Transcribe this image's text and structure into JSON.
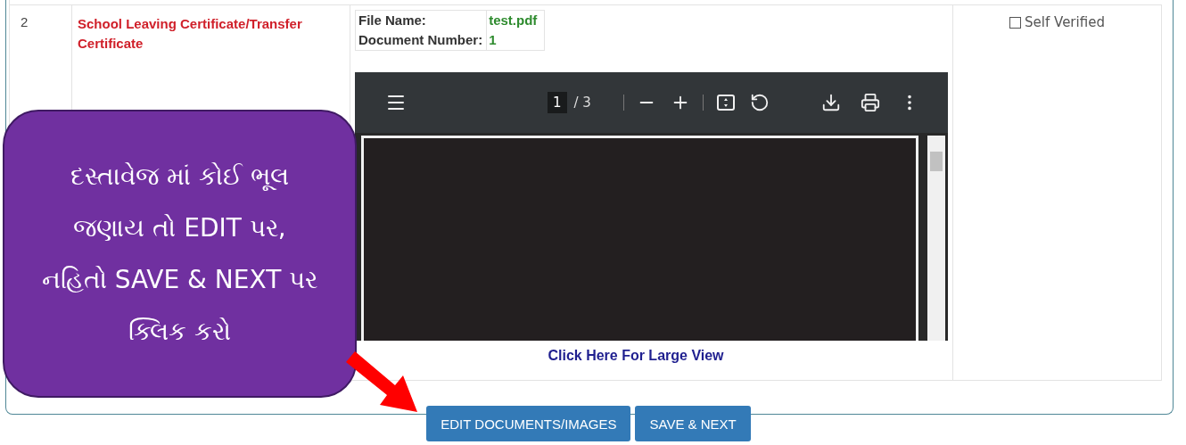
{
  "rows": [
    {
      "number": "2",
      "document_name": "School Leaving Certificate/Transfer Certificate",
      "file_fields": [
        {
          "label": "File Name:",
          "value": "test.pdf"
        },
        {
          "label": "Document Number:",
          "value": "1"
        }
      ],
      "viewer": {
        "page": "1",
        "page_count": "/ 3"
      },
      "large_view_link": "Click Here For Large View",
      "self_verified": {
        "label": "Self Verified",
        "checked": false
      }
    }
  ],
  "buttons": [
    {
      "label": "EDIT DOCUMENTS/IMAGES"
    },
    {
      "label": "SAVE & NEXT"
    }
  ],
  "callout": {
    "lines": [
      "દસ્તાવેજ માં કોઈ ભૂલ",
      "જણાય તો EDIT પર,",
      "નહિતો SAVE & NEXT પર",
      "ક્લિક કરો"
    ]
  }
}
